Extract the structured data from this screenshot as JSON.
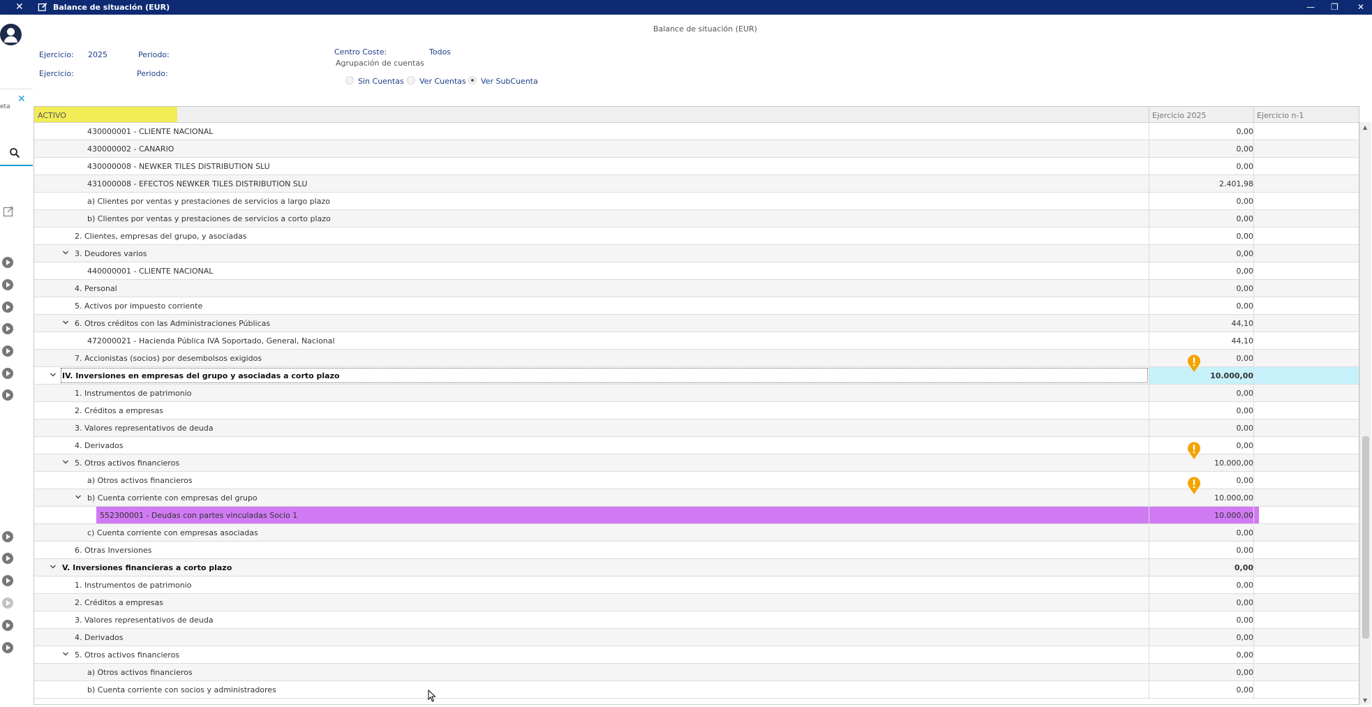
{
  "window": {
    "title": "Balance de situación (EUR)",
    "close_left": "✕",
    "minimize": "—",
    "restore": "❐",
    "close": "✕"
  },
  "left": {
    "panel_subtext": "eta",
    "panel_close": "✕"
  },
  "header": {
    "report_title": "Balance de situación (EUR)",
    "ejercicio_label": "Ejercicio:",
    "ejercicio_value": "2025",
    "periodo_label": "Periodo:",
    "ejercicio2_label": "Ejercicio:",
    "periodo2_label": "Periodo:",
    "centro_coste_label": "Centro Coste:",
    "centro_coste_value": "Todos",
    "agrupacion_label": "Agrupación de cuentas",
    "radio_sin_cuentas": "Sin Cuentas",
    "radio_ver_cuentas": "Ver Cuentas",
    "radio_ver_subcuenta": "Ver SubCuenta",
    "selected_radio": "Ver SubCuenta"
  },
  "table": {
    "col_activo": "ACTIVO",
    "col_ejercicio_actual": "Ejercicio 2025",
    "col_ejercicio_anterior": "Ejercicio n-1",
    "rows": [
      {
        "label": "430000001 - CLIENTE NACIONAL",
        "level": 3,
        "value": "0,00"
      },
      {
        "label": "430000002 - CANARIO",
        "level": 3,
        "value": "0,00"
      },
      {
        "label": "430000008 - NEWKER TILES DISTRIBUTION SLU",
        "level": 3,
        "value": "0,00"
      },
      {
        "label": "431000008 - EFECTOS NEWKER TILES DISTRIBUTION SLU",
        "level": 3,
        "value": "2.401,98"
      },
      {
        "label": "a) Clientes por ventas y prestaciones de servicios a largo plazo",
        "level": 3,
        "value": "0,00"
      },
      {
        "label": "b) Clientes por ventas y prestaciones de servicios a corto plazo",
        "level": 3,
        "value": "0,00"
      },
      {
        "label": "2. Clientes, empresas del grupo, y asociadas",
        "level": 2,
        "value": "0,00"
      },
      {
        "label": "3. Deudores varios",
        "level": 2,
        "value": "0,00",
        "expanded": true
      },
      {
        "label": "440000001 - CLIENTE NACIONAL",
        "level": 3,
        "value": "0,00"
      },
      {
        "label": "4. Personal",
        "level": 2,
        "value": "0,00"
      },
      {
        "label": "5. Activos por impuesto corriente",
        "level": 2,
        "value": "0,00"
      },
      {
        "label": "6. Otros créditos con las Administraciones Públicas",
        "level": 2,
        "value": "44,10",
        "expanded": true
      },
      {
        "label": "472000021 - Hacienda Pública IVA Soportado, General, Nacional",
        "level": 3,
        "value": "44,10"
      },
      {
        "label": "7. Accionistas (socios) por desembolsos exigidos",
        "level": 2,
        "value": "0,00"
      },
      {
        "label": "IV. Inversiones en empresas del grupo y asociadas a corto plazo",
        "level": 1,
        "value": "10.000,00",
        "expanded": true,
        "bold": true,
        "selected": true
      },
      {
        "label": "1. Instrumentos de patrimonio",
        "level": 2,
        "value": "0,00"
      },
      {
        "label": "2. Créditos a empresas",
        "level": 2,
        "value": "0,00"
      },
      {
        "label": "3. Valores representativos de deuda",
        "level": 2,
        "value": "0,00"
      },
      {
        "label": "4. Derivados",
        "level": 2,
        "value": "0,00"
      },
      {
        "label": "5. Otros activos financieros",
        "level": 2,
        "value": "10.000,00",
        "expanded": true
      },
      {
        "label": "a) Otros activos financieros",
        "level": 3,
        "value": "0,00"
      },
      {
        "label": "b) Cuenta corriente con empresas del grupo",
        "level": 3,
        "value": "10.000,00",
        "expanded": true
      },
      {
        "label": "552300001 - Deudas con partes vinculadas Socio 1",
        "level": 4,
        "value": "10.000,00",
        "highlight": "#d07af3"
      },
      {
        "label": "c) Cuenta corriente con empresas asociadas",
        "level": 3,
        "value": "0,00"
      },
      {
        "label": "6. Otras Inversiones",
        "level": 2,
        "value": "0,00"
      },
      {
        "label": "V. Inversiones financieras a corto plazo",
        "level": 1,
        "value": "0,00",
        "expanded": true,
        "bold": true
      },
      {
        "label": "1. Instrumentos de patrimonio",
        "level": 2,
        "value": "0,00"
      },
      {
        "label": "2. Créditos a empresas",
        "level": 2,
        "value": "0,00"
      },
      {
        "label": "3. Valores representativos de deuda",
        "level": 2,
        "value": "0,00"
      },
      {
        "label": "4. Derivados",
        "level": 2,
        "value": "0,00"
      },
      {
        "label": "5. Otros activos financieros",
        "level": 2,
        "value": "0,00",
        "expanded": true
      },
      {
        "label": "a) Otros activos financieros",
        "level": 3,
        "value": "0,00"
      },
      {
        "label": "b) Cuenta corriente con socios y administradores",
        "level": 3,
        "value": "0,00"
      }
    ]
  },
  "colors": {
    "titlebar": "#0d2a73",
    "activo_header": "#f2ec56",
    "selected_value_cell": "#c7f1fb",
    "highlight_row": "#d07af3",
    "warning": "#f5a300",
    "link_text": "#1d3f87"
  },
  "icons": [
    "close-icon",
    "edit-icon",
    "minimize-icon",
    "restore-icon",
    "avatar-icon",
    "search-icon",
    "external-link-icon",
    "play-icon",
    "chevron-down-icon",
    "warning-marker-icon",
    "mouse-cursor-icon"
  ]
}
